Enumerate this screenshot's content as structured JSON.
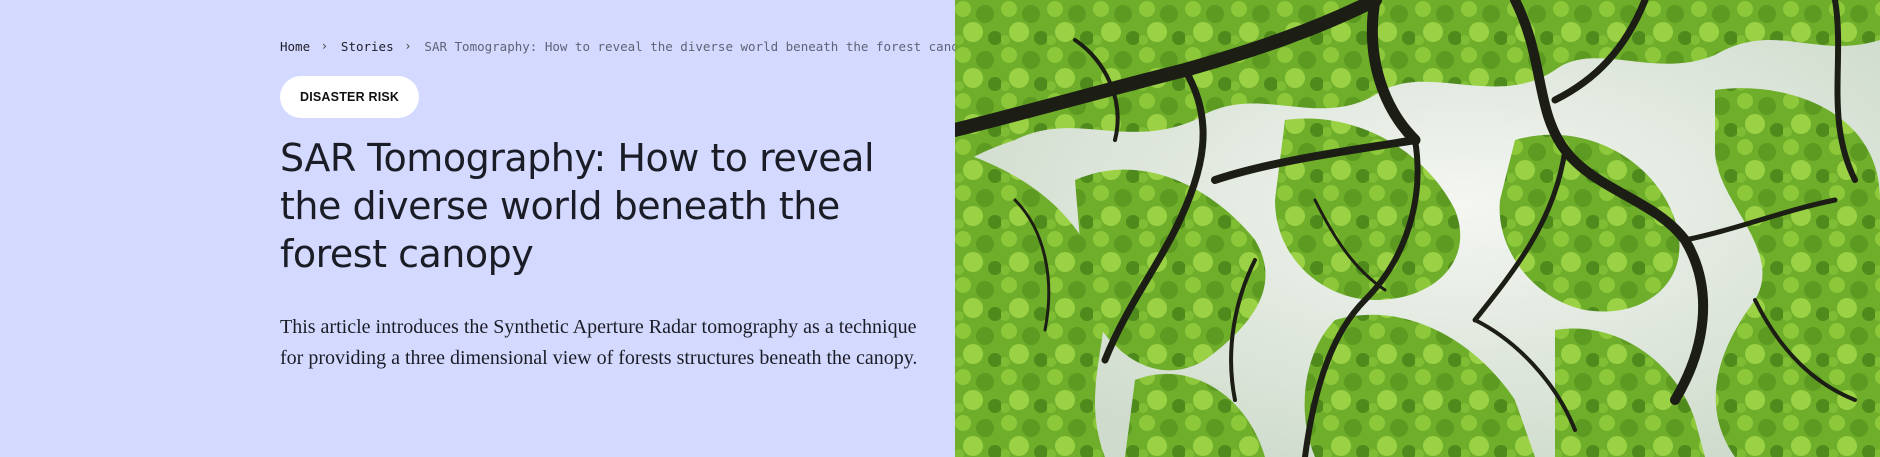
{
  "breadcrumb": {
    "home": "Home",
    "stories": "Stories",
    "current": "SAR Tomography: How to reveal the diverse world beneath the forest canopy",
    "separator_icon": "chevron-right-icon"
  },
  "tag": {
    "label": "DISASTER RISK"
  },
  "article": {
    "title": "SAR Tomography: How to reveal the diverse world beneath the forest canopy",
    "summary": "This article introduces the Synthetic Aperture Radar tomography as a technique for providing a three dimensional view of forests structures beneath the canopy."
  },
  "image": {
    "subject": "forest-canopy-photo"
  },
  "colors": {
    "panel_background": "#d4d9ff",
    "text": "#1b1d26",
    "tag_background": "#ffffff",
    "foliage": "#7cb82f",
    "branches": "#1c1d14"
  }
}
